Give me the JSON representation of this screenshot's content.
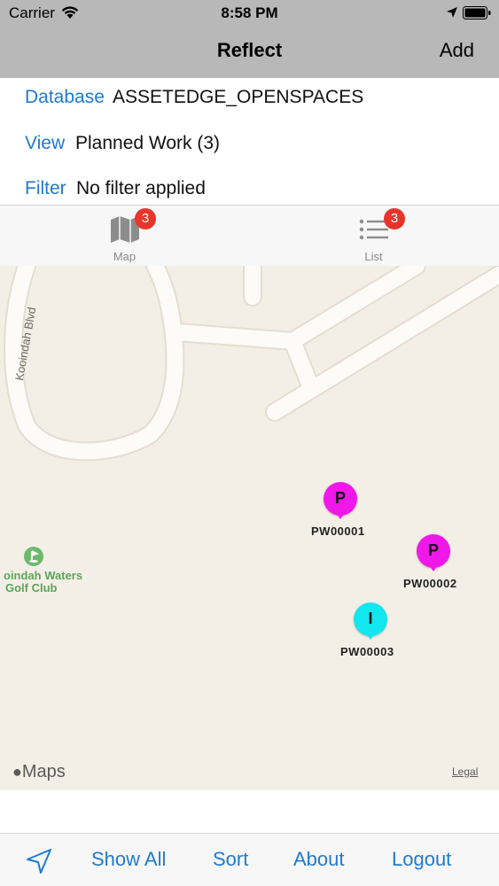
{
  "status_bar": {
    "carrier": "Carrier",
    "time": "8:58 PM"
  },
  "nav": {
    "title": "Reflect",
    "add_label": "Add"
  },
  "info": {
    "database_label": "Database",
    "database_value": "ASSETEDGE_OPENSPACES",
    "view_label": "View",
    "view_value": "Planned Work (3)",
    "filter_label": "Filter",
    "filter_value": "No filter applied"
  },
  "tabs": [
    {
      "label": "Map",
      "badge": "3",
      "icon": "map-icon"
    },
    {
      "label": "List",
      "badge": "3",
      "icon": "list-icon"
    }
  ],
  "map": {
    "street_label": "Kooindah Blvd",
    "golf_line1": "oindah Waters",
    "golf_line2": "Golf Club",
    "pins": [
      {
        "id": "PW00001",
        "letter": "P",
        "color": "#f018e8"
      },
      {
        "id": "PW00002",
        "letter": "P",
        "color": "#f018e8"
      },
      {
        "id": "PW00003",
        "letter": "I",
        "color": "#12e6ee"
      }
    ],
    "attribution": "Maps",
    "legal": "Legal"
  },
  "toolbar": {
    "show_all": "Show All",
    "sort": "Sort",
    "about": "About",
    "logout": "Logout"
  },
  "colors": {
    "accent": "#1f7ad1",
    "badge": "#e8352b",
    "navbar": "#b8b8b8"
  }
}
